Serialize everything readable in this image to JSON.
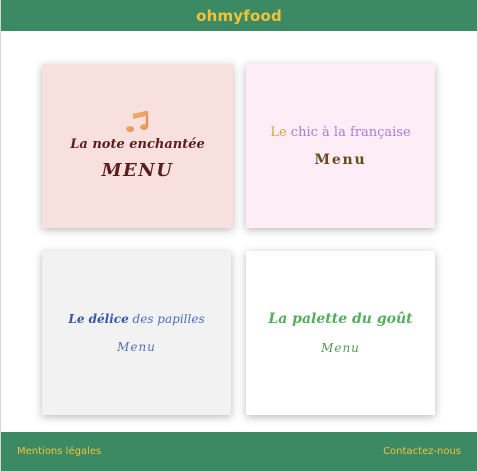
{
  "header": {
    "brand": "ohmyfood"
  },
  "cards": [
    {
      "title": "La note enchantée",
      "menu_label": "MENU",
      "icon": "music-note-icon",
      "background": "#f7e0dd"
    },
    {
      "title_first": "Le",
      "title_rest": " chic à la française",
      "menu_label": "Menu",
      "background": "#fcedf7"
    },
    {
      "title_bold": "Le délice",
      "title_rest": " des papilles",
      "menu_label": "Menu",
      "background": "#f2f2f2"
    },
    {
      "title": "La palette du goût",
      "menu_label": "Menu",
      "background": "#ffffff"
    }
  ],
  "footer": {
    "legal": "Mentions légales",
    "contact": "Contactez-nous"
  },
  "colors": {
    "brand_green": "#3b8a63",
    "brand_yellow": "#f2c23a"
  }
}
